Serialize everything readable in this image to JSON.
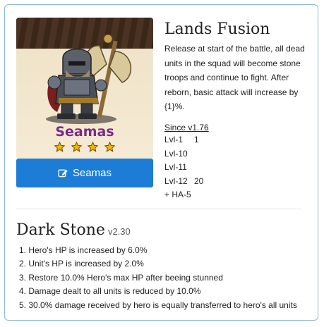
{
  "hero": {
    "name": "Seamas",
    "stars": 4,
    "button_label": "Seamas",
    "button_icon": "edit-icon"
  },
  "skill": {
    "title": "Lands Fusion",
    "description": "Release at start of the battle, all dead units in the squad will become stone troops and continue to fight. After reborn, basic attack will increase by {1}%.",
    "since": "Since v1.76",
    "levels": [
      {
        "level": "Lvl-1",
        "value": "1"
      },
      {
        "level": "Lvl-10",
        "value": ""
      },
      {
        "level": "Lvl-11",
        "value": ""
      },
      {
        "level": "Lvl-12",
        "value": "20"
      },
      {
        "level": "+ HA-5",
        "value": ""
      }
    ]
  },
  "stone": {
    "title": "Dark Stone",
    "version": "v2.30",
    "effects": [
      "1. Hero's HP is increased by 6.0%",
      "2. Unit's HP is increased by 2.0%",
      "3. Restore 10.0% Hero's max HP after beeing stunned",
      "4. Damage dealt to all units is reduced by 10.0%",
      "5. 30.0% damage received by hero is equally transferred to hero's all units"
    ]
  },
  "colors": {
    "accent": "#1d7dd6",
    "border": "#8fb8d6",
    "hero_name": "#7a2a88",
    "star": "#f2b705"
  }
}
